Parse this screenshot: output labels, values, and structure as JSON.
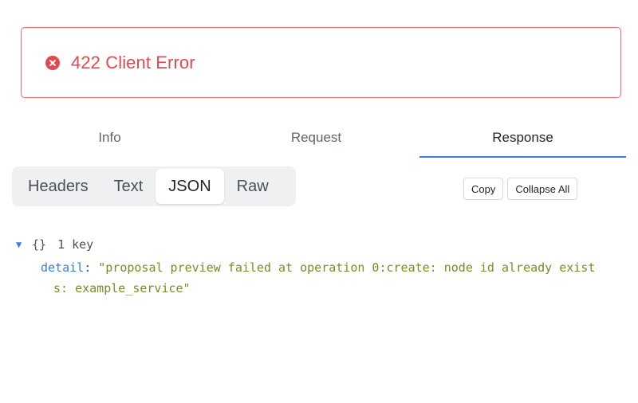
{
  "error": {
    "title": "422 Client Error",
    "icon": "x-circle-icon",
    "color": "#e5484d"
  },
  "main_tabs": [
    {
      "label": "Info",
      "active": false
    },
    {
      "label": "Request",
      "active": false
    },
    {
      "label": "Response",
      "active": true
    }
  ],
  "format_tabs": [
    {
      "label": "Headers",
      "active": false
    },
    {
      "label": "Text",
      "active": false
    },
    {
      "label": "JSON",
      "active": true
    },
    {
      "label": "Raw",
      "active": false
    }
  ],
  "toolbar": {
    "copy_label": "Copy",
    "collapse_label": "Collapse All"
  },
  "json_view": {
    "toggle_glyph": "▼",
    "brace": "{}",
    "key_count": "1 key",
    "entries": [
      {
        "key": "detail",
        "colon": ":",
        "value_line1": "\"proposal preview failed at operation 0:create: node id already exist",
        "value_line2": "s: example_service\""
      }
    ]
  },
  "colors": {
    "accent": "#3b7ddd",
    "error_border": "#ef6b6e",
    "string_value": "#7c8a27"
  }
}
